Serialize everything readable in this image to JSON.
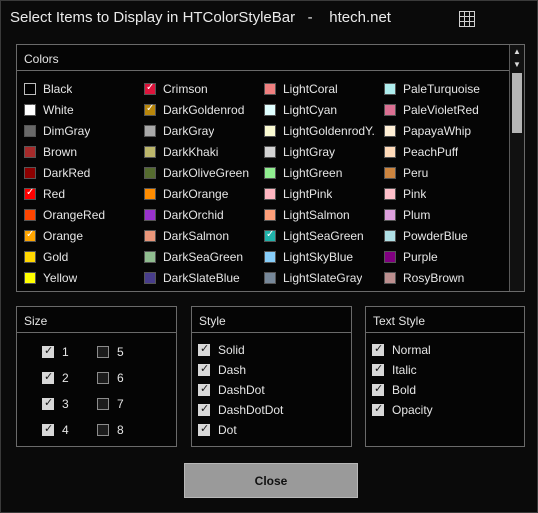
{
  "window": {
    "title": "Select Items to Display in HTColorStyleBar   -    htech.net"
  },
  "colors": {
    "header": "Colors",
    "columns": [
      [
        {
          "name": "Black",
          "swatch": "#000000",
          "checked": false
        },
        {
          "name": "White",
          "swatch": "#ffffff",
          "checked": true
        },
        {
          "name": "DimGray",
          "swatch": "#696969",
          "checked": false
        },
        {
          "name": "Brown",
          "swatch": "#a52a2a",
          "checked": false
        },
        {
          "name": "DarkRed",
          "swatch": "#8b0000",
          "checked": false
        },
        {
          "name": "Red",
          "swatch": "#ff0000",
          "checked": true
        },
        {
          "name": "OrangeRed",
          "swatch": "#ff4500",
          "checked": false
        },
        {
          "name": "Orange",
          "swatch": "#ffa500",
          "checked": true
        },
        {
          "name": "Gold",
          "swatch": "#ffd700",
          "checked": false
        },
        {
          "name": "Yellow",
          "swatch": "#ffff00",
          "checked": false
        }
      ],
      [
        {
          "name": "Crimson",
          "swatch": "#dc143c",
          "checked": true
        },
        {
          "name": "DarkGoldenrod",
          "swatch": "#b8860b",
          "checked": true
        },
        {
          "name": "DarkGray",
          "swatch": "#a9a9a9",
          "checked": false
        },
        {
          "name": "DarkKhaki",
          "swatch": "#bdb76b",
          "checked": false
        },
        {
          "name": "DarkOliveGreen",
          "swatch": "#556b2f",
          "checked": false
        },
        {
          "name": "DarkOrange",
          "swatch": "#ff8c00",
          "checked": false
        },
        {
          "name": "DarkOrchid",
          "swatch": "#9932cc",
          "checked": false
        },
        {
          "name": "DarkSalmon",
          "swatch": "#e9967a",
          "checked": false
        },
        {
          "name": "DarkSeaGreen",
          "swatch": "#8fbc8f",
          "checked": false
        },
        {
          "name": "DarkSlateBlue",
          "swatch": "#483d8b",
          "checked": false
        }
      ],
      [
        {
          "name": "LightCoral",
          "swatch": "#f08080",
          "checked": false
        },
        {
          "name": "LightCyan",
          "swatch": "#e0ffff",
          "checked": false
        },
        {
          "name": "LightGoldenrodY...",
          "swatch": "#fafad2",
          "checked": false
        },
        {
          "name": "LightGray",
          "swatch": "#d3d3d3",
          "checked": false
        },
        {
          "name": "LightGreen",
          "swatch": "#90ee90",
          "checked": false
        },
        {
          "name": "LightPink",
          "swatch": "#ffb6c1",
          "checked": false
        },
        {
          "name": "LightSalmon",
          "swatch": "#ffa07a",
          "checked": false
        },
        {
          "name": "LightSeaGreen",
          "swatch": "#20b2aa",
          "checked": true
        },
        {
          "name": "LightSkyBlue",
          "swatch": "#87cefa",
          "checked": false
        },
        {
          "name": "LightSlateGray",
          "swatch": "#778899",
          "checked": false
        }
      ],
      [
        {
          "name": "PaleTurquoise",
          "swatch": "#afeeee",
          "checked": false
        },
        {
          "name": "PaleVioletRed",
          "swatch": "#db7093",
          "checked": false
        },
        {
          "name": "PapayaWhip",
          "swatch": "#ffefd5",
          "checked": false
        },
        {
          "name": "PeachPuff",
          "swatch": "#ffdab9",
          "checked": false
        },
        {
          "name": "Peru",
          "swatch": "#cd853f",
          "checked": false
        },
        {
          "name": "Pink",
          "swatch": "#ffc0cb",
          "checked": false
        },
        {
          "name": "Plum",
          "swatch": "#dda0dd",
          "checked": false
        },
        {
          "name": "PowderBlue",
          "swatch": "#b0e0e6",
          "checked": false
        },
        {
          "name": "Purple",
          "swatch": "#800080",
          "checked": false
        },
        {
          "name": "RosyBrown",
          "swatch": "#bc8f8f",
          "checked": false
        }
      ]
    ]
  },
  "size": {
    "header": "Size",
    "items": [
      {
        "label": "1",
        "checked": true
      },
      {
        "label": "2",
        "checked": true
      },
      {
        "label": "3",
        "checked": true
      },
      {
        "label": "4",
        "checked": true
      },
      {
        "label": "5",
        "checked": false
      },
      {
        "label": "6",
        "checked": false
      },
      {
        "label": "7",
        "checked": false
      },
      {
        "label": "8",
        "checked": false
      }
    ]
  },
  "style": {
    "header": "Style",
    "items": [
      {
        "label": "Solid",
        "checked": true
      },
      {
        "label": "Dash",
        "checked": true
      },
      {
        "label": "DashDot",
        "checked": true
      },
      {
        "label": "DashDotDot",
        "checked": true
      },
      {
        "label": "Dot",
        "checked": true
      }
    ]
  },
  "text_style": {
    "header": "Text Style",
    "items": [
      {
        "label": "Normal",
        "checked": true
      },
      {
        "label": "Italic",
        "checked": true
      },
      {
        "label": "Bold",
        "checked": true
      },
      {
        "label": "Opacity",
        "checked": true
      }
    ]
  },
  "close_button": {
    "label": "Close"
  }
}
